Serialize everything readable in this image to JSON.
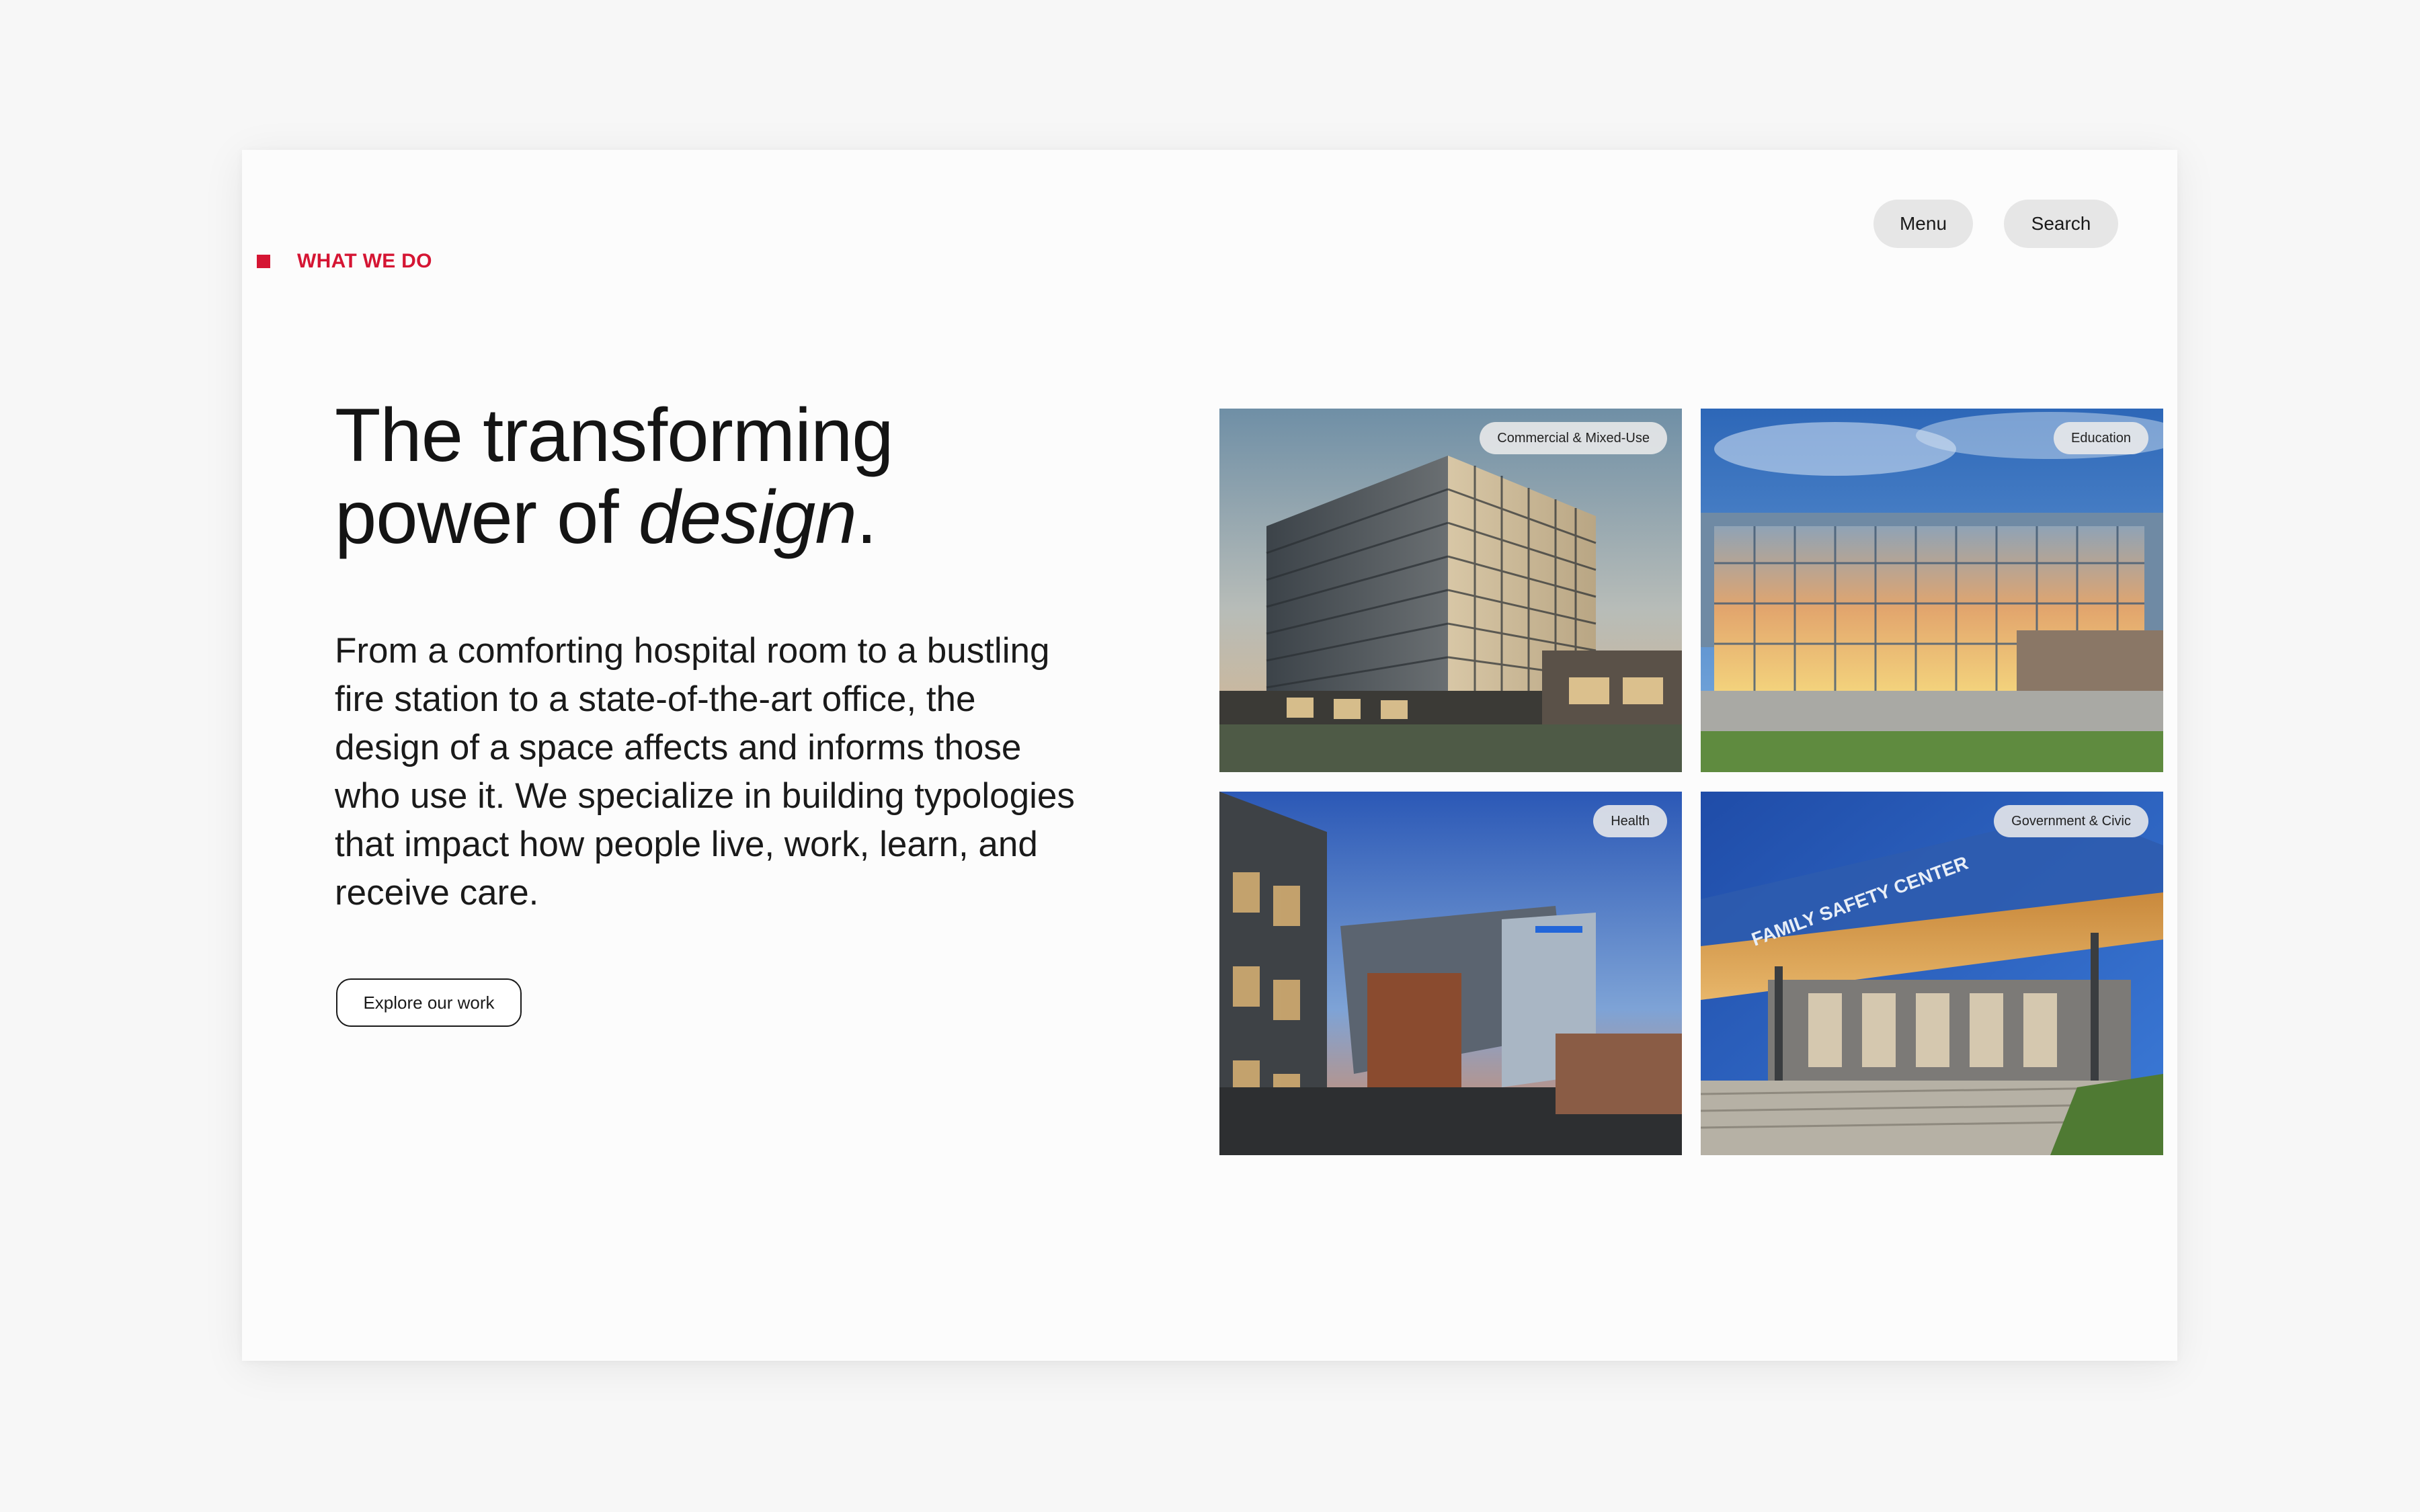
{
  "eyebrow": {
    "label": "WHAT WE DO"
  },
  "nav": {
    "menu_label": "Menu",
    "search_label": "Search"
  },
  "hero": {
    "headline_line1": "The transforming",
    "headline_line2_prefix": "power of ",
    "headline_line2_emphasis": "design",
    "headline_line2_suffix": ".",
    "body": "From a comforting hospital room to a bustling fire station to a state-of-the-art office, the design of a space affects and informs those who use it. We specialize in building typologies that impact how people live, work, learn, and receive care.",
    "cta_label": "Explore our work"
  },
  "categories": [
    {
      "label": "Commercial & Mixed-Use",
      "image": "commercial-building-photo"
    },
    {
      "label": "Education",
      "image": "education-building-photo"
    },
    {
      "label": "Health",
      "image": "health-building-photo"
    },
    {
      "label": "Government & Civic",
      "image": "government-building-photo",
      "sign_text": "FAMILY SAFETY CENTER"
    }
  ],
  "colors": {
    "accent": "#d51533",
    "pill_bg": "#e6e6e6",
    "page_bg": "#f7f7f7"
  }
}
